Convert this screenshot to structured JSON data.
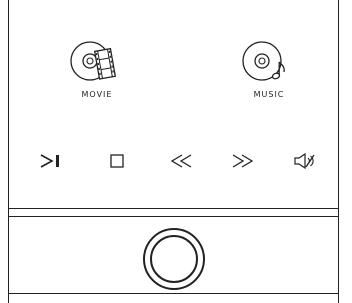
{
  "media": {
    "movie_label": "MOVIE",
    "music_label": "MUSIC"
  },
  "controls": [
    {
      "name": "next-track",
      "icon": "next-track-icon"
    },
    {
      "name": "stop",
      "icon": "stop-icon"
    },
    {
      "name": "rewind",
      "icon": "rewind-icon"
    },
    {
      "name": "fast-forward",
      "icon": "fast-forward-icon"
    },
    {
      "name": "mute",
      "icon": "mute-icon"
    }
  ],
  "colors": {
    "line": "#222222",
    "background": "#ffffff"
  }
}
